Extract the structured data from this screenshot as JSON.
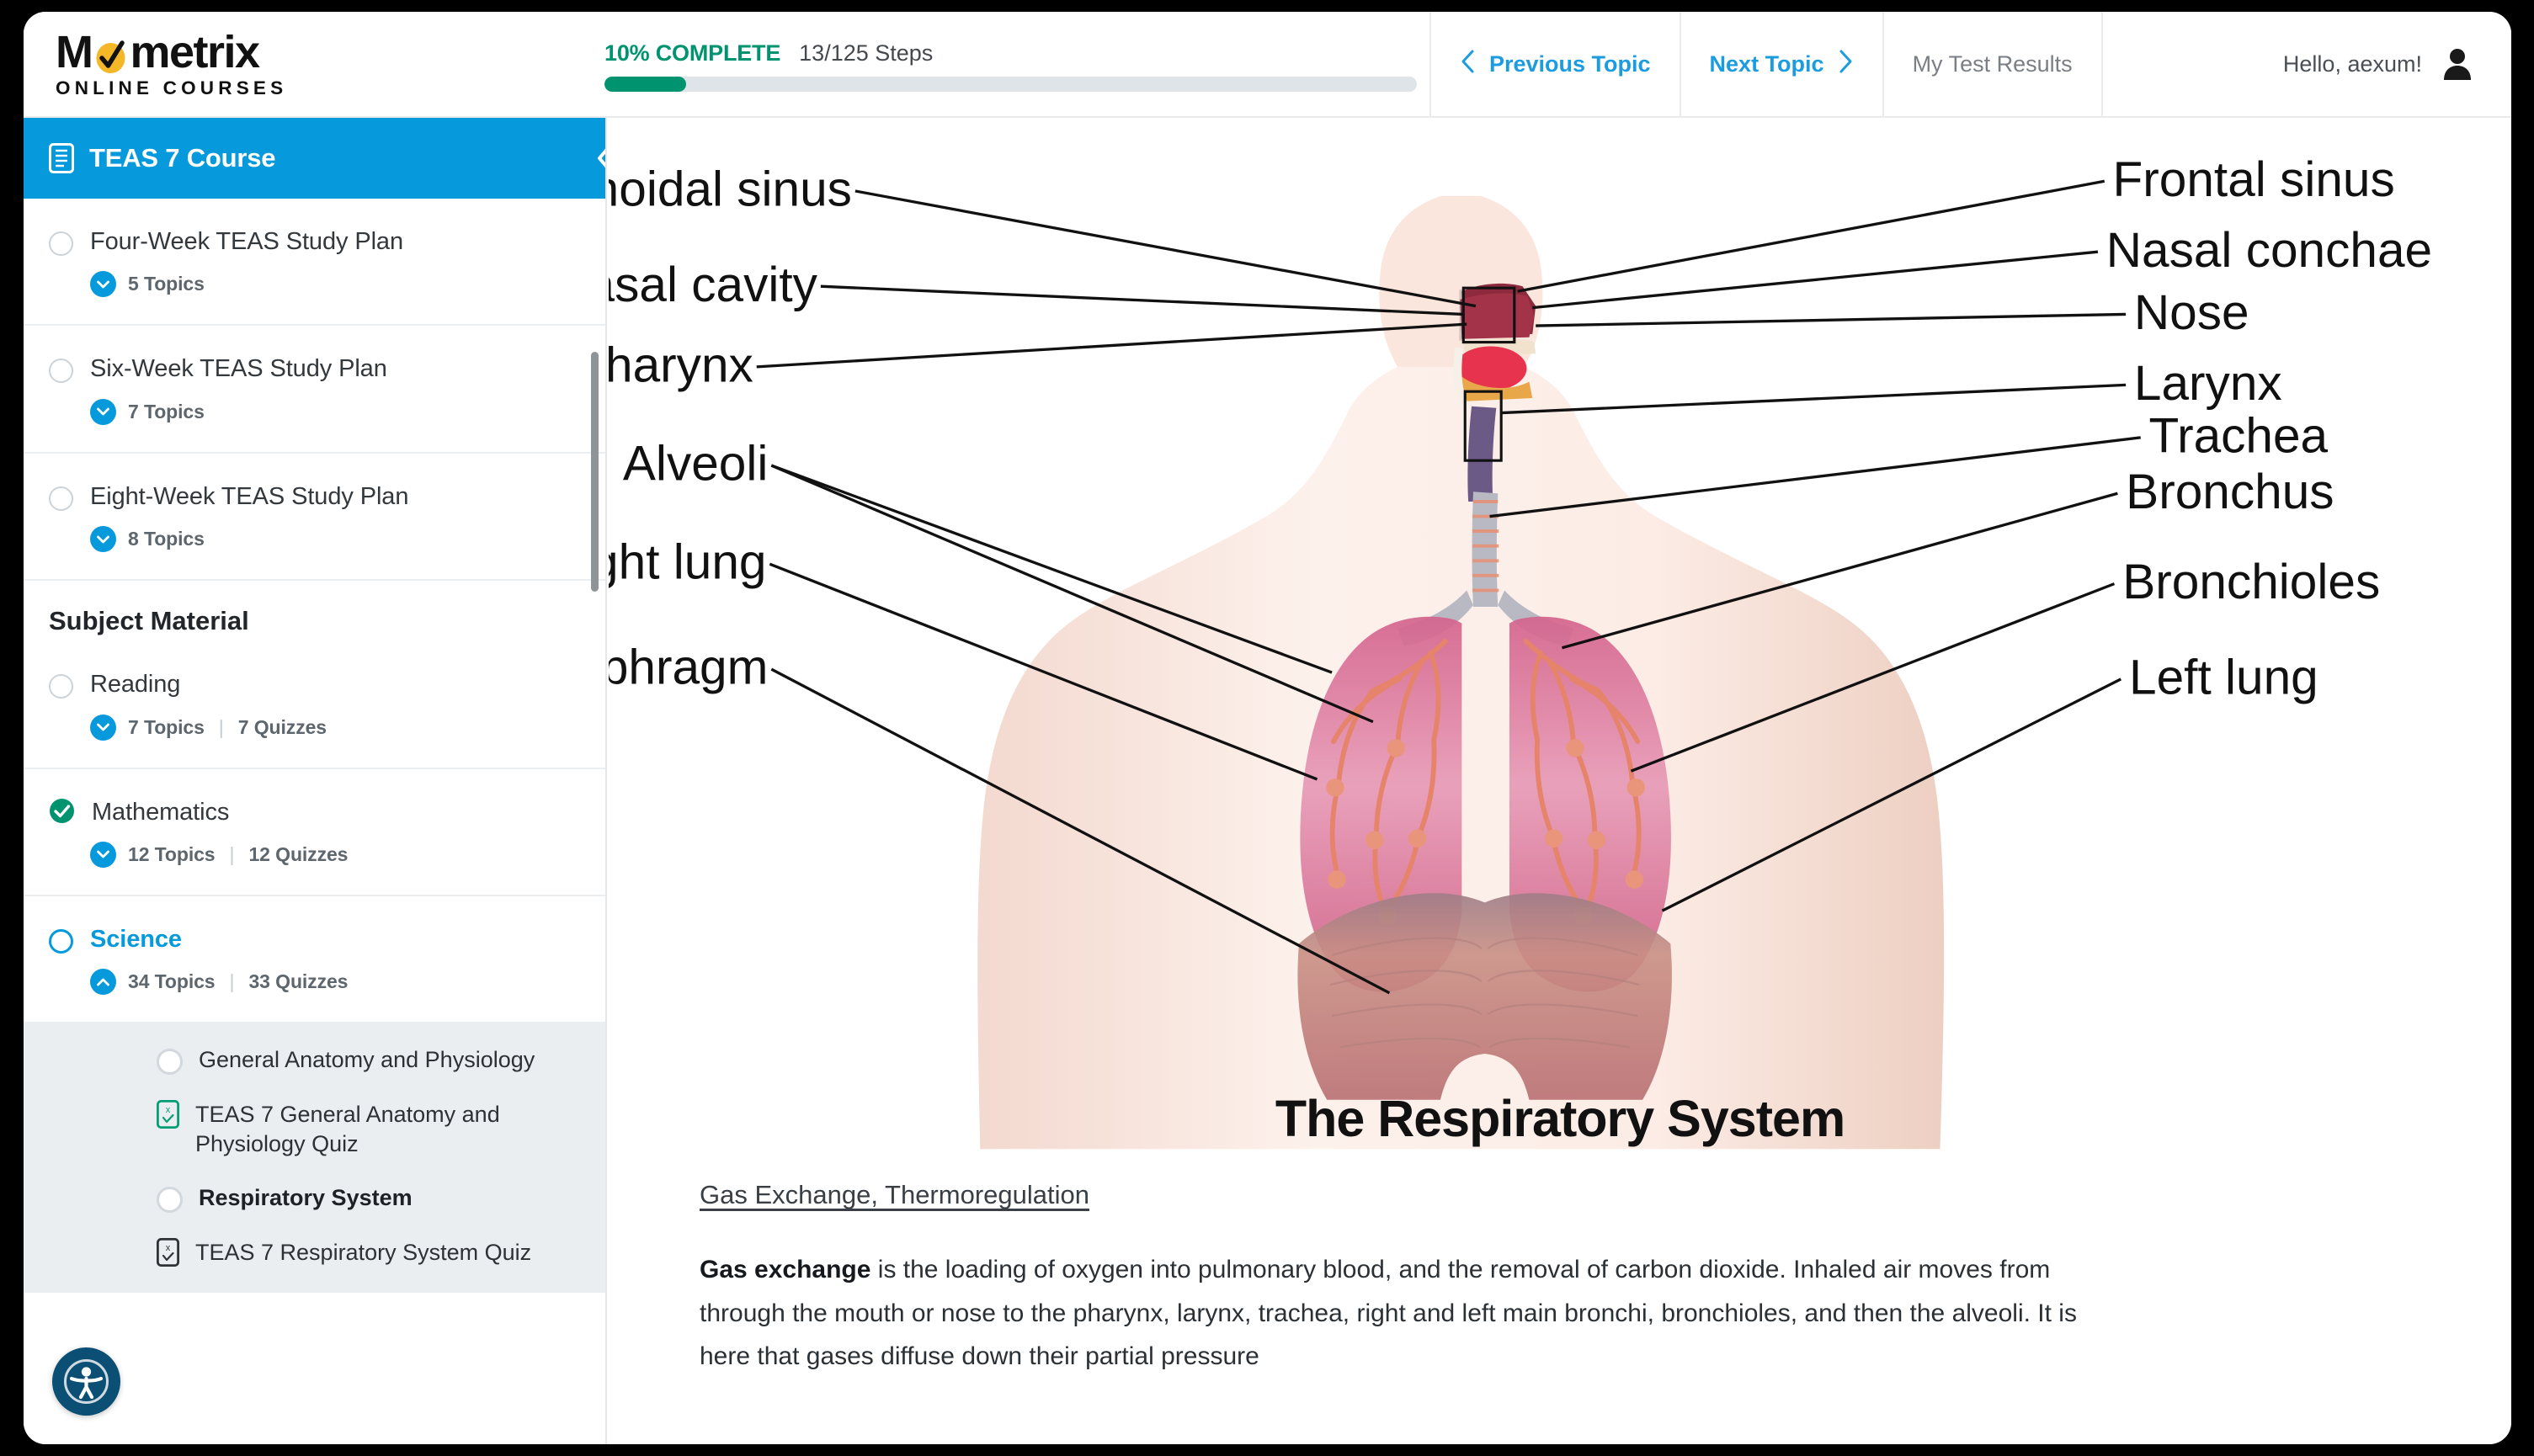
{
  "header": {
    "logo_main": "Mometrix",
    "logo_sub": "ONLINE COURSES",
    "progress": {
      "percent_label": "10% COMPLETE",
      "steps_label": "13/125 Steps",
      "percent_value": 10,
      "completed_steps": 13,
      "total_steps": 125,
      "bar_color": "#00936f"
    },
    "nav": {
      "previous_label": "Previous Topic",
      "next_label": "Next Topic",
      "results_label": "My Test Results",
      "greeting": "Hello, aexum!"
    }
  },
  "sidebar": {
    "course_title": "TEAS 7 Course",
    "collapse_label": "Collapse sidebar",
    "lessons": [
      {
        "name": "Four-Week TEAS Study Plan",
        "topics": "5 Topics",
        "quizzes": "",
        "status": "incomplete",
        "expanded": false
      },
      {
        "name": "Six-Week TEAS Study Plan",
        "topics": "7 Topics",
        "quizzes": "",
        "status": "incomplete",
        "expanded": false
      },
      {
        "name": "Eight-Week TEAS Study Plan",
        "topics": "8 Topics",
        "quizzes": "",
        "status": "incomplete",
        "expanded": false
      }
    ],
    "section_title": "Subject Material",
    "subjects": [
      {
        "name": "Reading",
        "topics": "7 Topics",
        "quizzes": "7 Quizzes",
        "status": "incomplete",
        "expanded": false
      },
      {
        "name": "Mathematics",
        "topics": "12 Topics",
        "quizzes": "12 Quizzes",
        "status": "complete",
        "expanded": false
      },
      {
        "name": "Science",
        "topics": "34 Topics",
        "quizzes": "33 Quizzes",
        "status": "current",
        "expanded": true
      }
    ],
    "science_topics": [
      {
        "label": "General Anatomy and Physiology",
        "type": "topic",
        "state": "incomplete",
        "current": false
      },
      {
        "label": "TEAS 7 General Anatomy and Physiology Quiz",
        "type": "quiz",
        "state": "complete",
        "current": false
      },
      {
        "label": "Respiratory System",
        "type": "topic",
        "state": "incomplete",
        "current": true
      },
      {
        "label": "TEAS 7 Respiratory System Quiz",
        "type": "quiz",
        "state": "incomplete",
        "current": false
      }
    ],
    "accessibility_label": "Accessibility options"
  },
  "main": {
    "diagram": {
      "title": "The Respiratory System",
      "labels_left": [
        "Sphenoidal sinus",
        "Nasal cavity",
        "Pharynx",
        "Alveoli",
        "Right lung",
        "Diaphragm"
      ],
      "labels_right": [
        "Frontal sinus",
        "Nasal conchae",
        "Nose",
        "Larynx",
        "Trachea",
        "Bronchus",
        "Bronchioles",
        "Left lung"
      ]
    },
    "lesson_link": "Gas Exchange, Thermoregulation",
    "paragraph_lead": "Gas exchange",
    "paragraph_rest": " is the loading of oxygen into pulmonary blood, and the removal of carbon dioxide. Inhaled air moves from through the mouth or nose to the pharynx, larynx, trachea, right and left main bronchi, bronchioles, and then the alveoli. It is here that gases diffuse down their partial pressure"
  },
  "colors": {
    "brand_blue": "#069add",
    "green": "#00936f",
    "sidebar_panel": "#eaeef1"
  }
}
